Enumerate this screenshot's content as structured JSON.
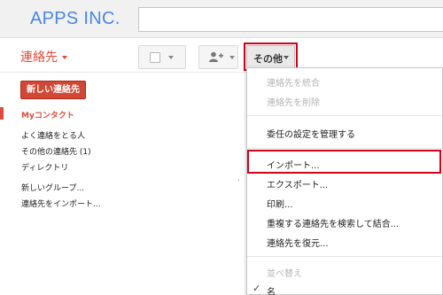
{
  "header": {
    "logo": "APPS INC.",
    "search_value": ""
  },
  "app": {
    "title": "連絡先"
  },
  "toolbar": {
    "more_label": "その他"
  },
  "sidebar": {
    "new_contact_label": "新しい連絡先",
    "items": [
      {
        "label": "Myコンタクト",
        "active": true
      },
      {
        "label": "よく連絡をとる人"
      },
      {
        "label": "その他の連絡先 (1)"
      },
      {
        "label": "ディレクトリ"
      },
      {
        "label": "新しいグループ..."
      },
      {
        "label": "連絡先をインポート..."
      }
    ]
  },
  "menu": {
    "items": [
      {
        "label": "連絡先を統合",
        "disabled": true
      },
      {
        "label": "連絡先を削除",
        "disabled": true
      },
      {
        "label": "委任の設定を管理する"
      },
      {
        "label": "インポート...",
        "highlighted": true
      },
      {
        "label": "エクスポート..."
      },
      {
        "label": "印刷..."
      },
      {
        "label": "重複する連絡先を検索して結合..."
      },
      {
        "label": "連絡先を復元..."
      },
      {
        "label": "並べ替え",
        "disabled": true
      },
      {
        "label": "名",
        "checked": true
      }
    ]
  },
  "colors": {
    "accent": "#dd4b39",
    "highlight": "#d0021b",
    "logo": "#4a86e8"
  }
}
